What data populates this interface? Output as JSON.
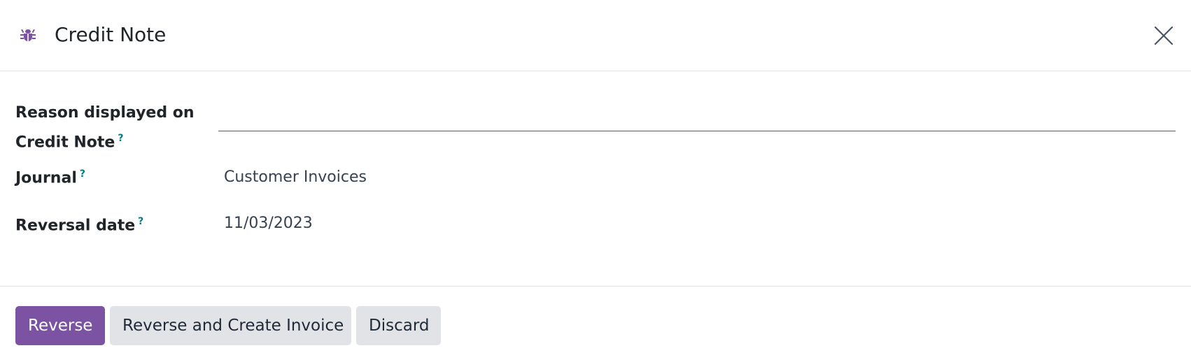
{
  "header": {
    "title": "Credit Note",
    "icon": "bug-icon",
    "close_icon": "close-icon"
  },
  "form": {
    "reason": {
      "label_line1": "Reason displayed on",
      "label_line2": "Credit Note",
      "help": "?",
      "value": "",
      "placeholder": ""
    },
    "journal": {
      "label": "Journal",
      "help": "?",
      "value": "Customer Invoices"
    },
    "reversal_date": {
      "label": "Reversal date",
      "help": "?",
      "value": "11/03/2023"
    }
  },
  "footer": {
    "reverse_label": "Reverse",
    "reverse_create_label": "Reverse and Create Invoice",
    "discard_label": "Discard"
  },
  "colors": {
    "primary": "#7c53a2",
    "help": "#017e84",
    "input_underline": "#714b67",
    "secondary_button": "#e1e3e6"
  }
}
